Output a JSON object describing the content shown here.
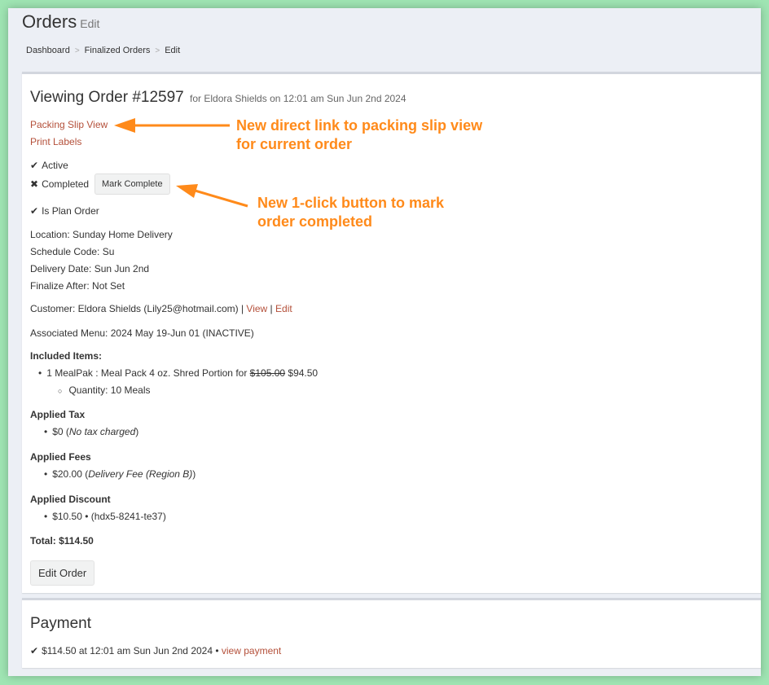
{
  "header": {
    "title": "Orders",
    "subtitle": "Edit"
  },
  "breadcrumb": {
    "items": [
      "Dashboard",
      "Finalized Orders",
      "Edit"
    ],
    "separator": ">"
  },
  "order": {
    "heading": "Viewing Order #12597",
    "for_text": "for Eldora Shields on 12:01 am Sun Jun 2nd 2024",
    "links": {
      "packing_slip": "Packing Slip View",
      "print_labels": "Print Labels"
    },
    "status": {
      "active": "Active",
      "completed": "Completed",
      "mark_complete_button": "Mark Complete",
      "is_plan_order": "Is Plan Order"
    },
    "details": {
      "location": "Location: Sunday Home Delivery",
      "schedule_code": "Schedule Code: Su",
      "delivery_date": "Delivery Date: Sun Jun 2nd",
      "finalize_after": "Finalize After: Not Set"
    },
    "customer": {
      "text": "Customer: Eldora Shields (Lily25@hotmail.com) |",
      "view_link": "View",
      "separator": "|",
      "edit_link": "Edit"
    },
    "associated_menu": "Associated Menu: 2024 May 19-Jun 01 (INACTIVE)",
    "included_items": {
      "heading": "Included Items:",
      "item_text": "1 MealPak : Meal Pack 4 oz. Shred Portion for",
      "original_price": "$105.00",
      "price": "$94.50",
      "sub": "Quantity: 10 Meals"
    },
    "tax": {
      "heading": "Applied Tax",
      "amount": "$0 (",
      "note": "No tax charged",
      "close": ")"
    },
    "fees": {
      "heading": "Applied Fees",
      "amount": "$20.00 (",
      "note": "Delivery Fee (Region B)",
      "close": ")"
    },
    "discount": {
      "heading": "Applied Discount",
      "text": "$10.50 • (hdx5-8241-te37)"
    },
    "total": "Total: $114.50",
    "edit_button": "Edit Order"
  },
  "payment": {
    "heading": "Payment",
    "text": "$114.50 at 12:01 am Sun Jun 2nd 2024 •",
    "link": "view payment"
  },
  "annotations": {
    "packing_slip_note": [
      "New direct link to packing slip view",
      "for current order"
    ],
    "mark_complete_note": [
      "New 1-click button to mark",
      "order completed"
    ],
    "color": "#ff8a1a"
  },
  "icons": {
    "check": "check-icon",
    "cross": "cross-icon"
  },
  "colors": {
    "link": "#b4503a",
    "background": "#9fe5b3",
    "window": "#eceff5"
  }
}
